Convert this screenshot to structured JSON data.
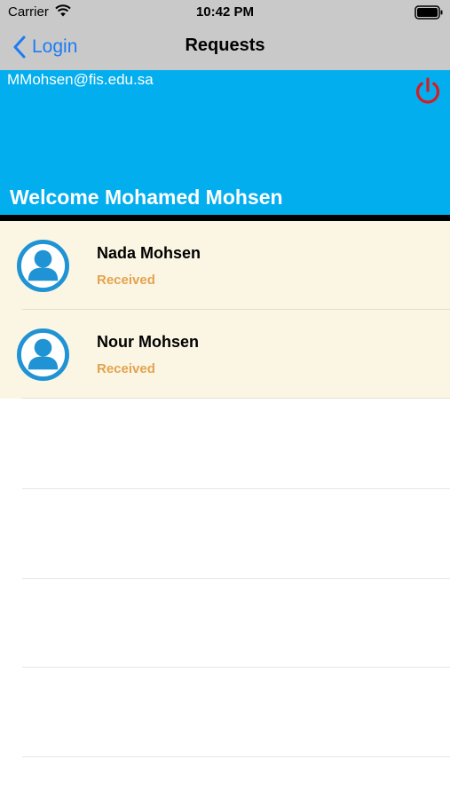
{
  "status_bar": {
    "carrier": "Carrier",
    "time": "10:42 PM"
  },
  "nav": {
    "back_label": "Login",
    "title": "Requests"
  },
  "header": {
    "email": "MMohsen@fis.edu.sa",
    "welcome": "Welcome Mohamed Mohsen",
    "background_color": "#02aeee",
    "power_icon_color": "#d51d23"
  },
  "requests": [
    {
      "name": "Nada Mohsen",
      "status": "Received"
    },
    {
      "name": "Nour Mohsen",
      "status": "Received"
    }
  ],
  "colors": {
    "accent": "#1c7cf4",
    "row_background": "#fbf6e3",
    "status_text": "#e3a34f",
    "avatar": "#1f93d4"
  },
  "icons": [
    "wifi-icon",
    "battery-icon",
    "chevron-left-icon",
    "power-icon",
    "avatar-icon"
  ]
}
